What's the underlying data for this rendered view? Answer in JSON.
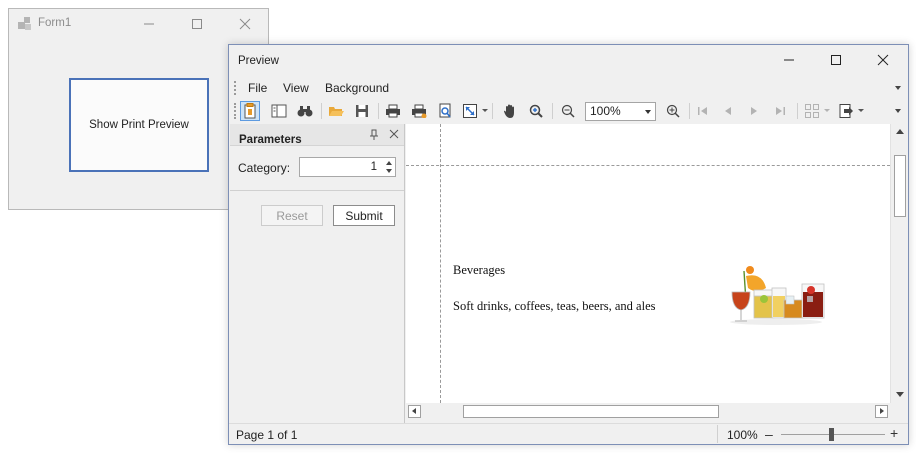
{
  "form1": {
    "title": "Form1",
    "show_preview_label": "Show Print Preview"
  },
  "preview": {
    "title": "Preview",
    "menu": [
      "File",
      "View",
      "Background"
    ],
    "toolbar": {
      "zoom_value": "100%",
      "icons": [
        "parameters-icon",
        "document-map-icon",
        "search-binoculars-icon",
        "open-folder-icon",
        "save-icon",
        "print-icon",
        "quick-print-icon",
        "page-setup-icon",
        "scale-icon",
        "hand-tool-icon",
        "magnifier-icon",
        "zoom-out-icon",
        "zoom-in-icon",
        "first-page-icon",
        "previous-page-icon",
        "next-page-icon",
        "last-page-icon",
        "multiple-pages-icon",
        "export-icon"
      ]
    },
    "parameters": {
      "title": "Parameters",
      "category_label": "Category:",
      "category_value": "1",
      "reset_label": "Reset",
      "submit_label": "Submit"
    },
    "document": {
      "category_name": "Beverages",
      "description": "Soft drinks, coffees, teas, beers, and ales"
    },
    "status": {
      "page": "Page 1 of 1",
      "zoom": "100%",
      "minus": "–",
      "plus": "+",
      "zoom_level_percent": 100
    }
  },
  "colors": {
    "accent_border": "#4a72b8",
    "window_border": "#7d8fb6",
    "toolbar_active": "#cde3f8"
  }
}
